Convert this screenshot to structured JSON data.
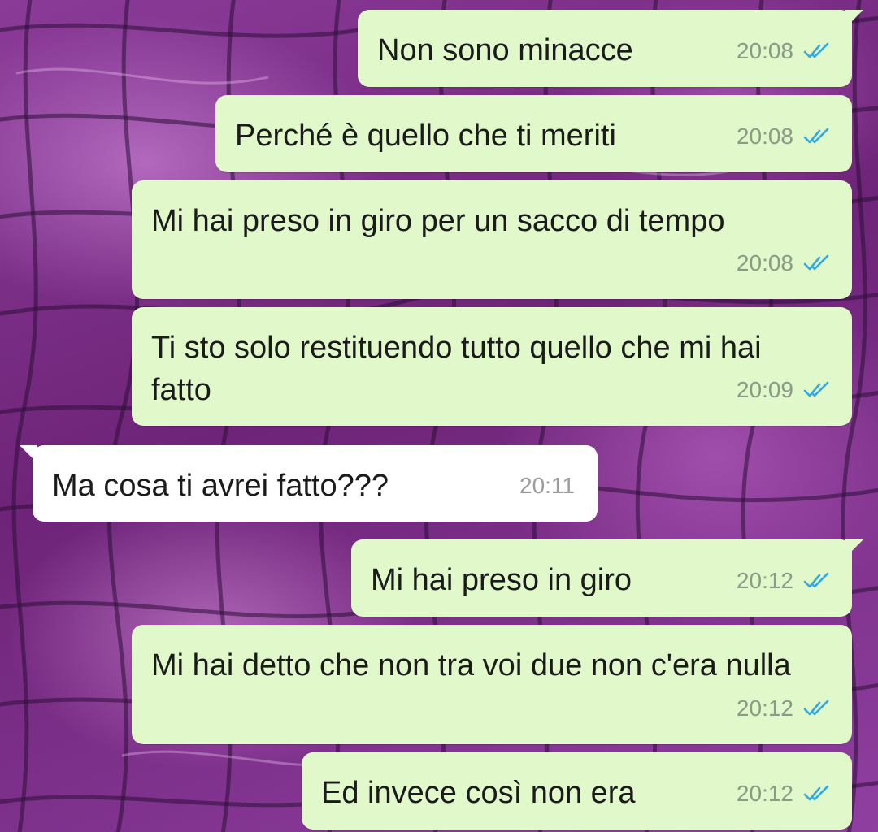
{
  "colors": {
    "outgoing_bubble": "#e1f8cb",
    "incoming_bubble": "#ffffff",
    "read_checks": "#34a8e0",
    "wallpaper": "#7a2a86"
  },
  "messages": [
    {
      "direction": "out",
      "text": "Non sono minacce",
      "time": "20:08",
      "status": "read",
      "status_icon": "double-check-icon"
    },
    {
      "direction": "out",
      "text": "Perché è quello che ti meriti",
      "time": "20:08",
      "status": "read",
      "status_icon": "double-check-icon"
    },
    {
      "direction": "out",
      "text": "Mi hai preso in giro per un sacco di tempo",
      "time": "20:08",
      "status": "read",
      "status_icon": "double-check-icon"
    },
    {
      "direction": "out",
      "text": "Ti sto solo restituendo tutto quello che mi hai fatto",
      "time": "20:09",
      "status": "read",
      "status_icon": "double-check-icon"
    },
    {
      "direction": "in",
      "text": "Ma cosa ti avrei fatto???",
      "time": "20:11"
    },
    {
      "direction": "out",
      "text": "Mi hai preso in giro",
      "time": "20:12",
      "status": "read",
      "status_icon": "double-check-icon"
    },
    {
      "direction": "out",
      "text": "Mi hai detto che non tra voi due non c'era nulla",
      "time": "20:12",
      "status": "read",
      "status_icon": "double-check-icon"
    },
    {
      "direction": "out",
      "text": "Ed invece così non era",
      "time": "20:12",
      "status": "read",
      "status_icon": "double-check-icon"
    }
  ]
}
